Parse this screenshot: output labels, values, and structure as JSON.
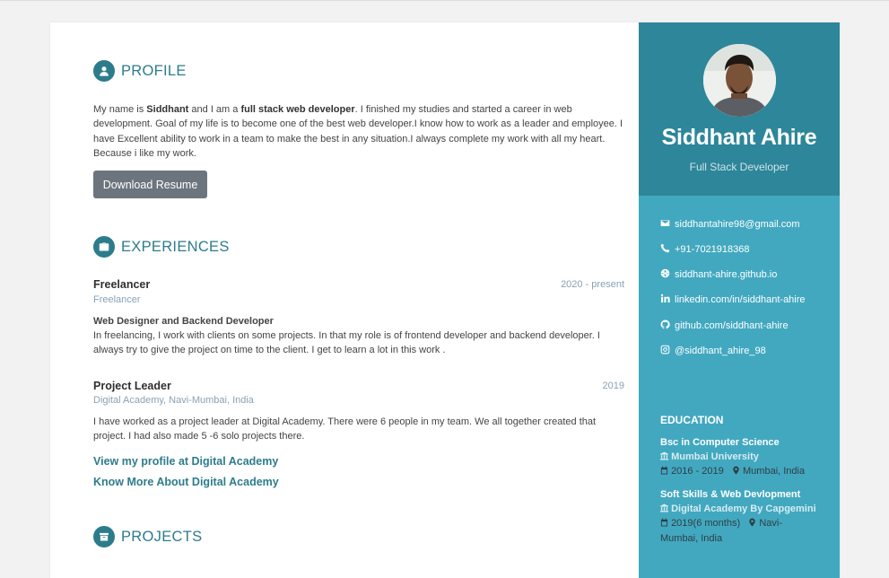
{
  "profile": {
    "heading": "PROFILE",
    "intro": "My name is ",
    "name_bold": "Siddhant",
    "mid": " and I am a ",
    "role_bold": "full stack web developer",
    "rest": ". I finished my studies and started a career in web development. Goal of my life is to become one of the best web developer.I know how to work as a leader and employee. I have Excellent ability to work in a team to make the best in any situation.I always complete my work with all my heart. Because i like my work.",
    "download_label": "Download Resume"
  },
  "experiences": {
    "heading": "EXPERIENCES",
    "items": [
      {
        "title": "Freelancer",
        "company": "Freelancer",
        "date": "2020 - present",
        "role": "Web Designer and Backend Developer",
        "description": "In freelancing, I work with clients on some projects. In that my role is of frontend developer and backend developer. I always try to give the project on time to the client. I get to learn a lot in this work ."
      },
      {
        "title": "Project Leader",
        "company": "Digital Academy, Navi-Mumbai, India",
        "date": "2019",
        "description": "I have worked as a project leader at Digital Academy. There were 6 people in my team. We all together created that project. I had also made 5 -6 solo projects there."
      }
    ],
    "link_profile": "View my profile at Digital Academy",
    "link_more": "Know More About Digital Academy"
  },
  "projects": {
    "heading": "PROJECTS"
  },
  "sidebar": {
    "name": "Siddhant Ahire",
    "role": "Full Stack Developer",
    "contacts": {
      "email": "siddhantahire98@gmail.com",
      "phone": "+91-7021918368",
      "website": "siddhant-ahire.github.io",
      "linkedin": "linkedin.com/in/siddhant-ahire",
      "github": "github.com/siddhant-ahire",
      "instagram": "@siddhant_ahire_98"
    },
    "education": {
      "heading": "EDUCATION",
      "items": [
        {
          "degree": "Bsc in Computer Science",
          "institution": "Mumbai University",
          "years": "2016 - 2019",
          "location": "Mumbai, India"
        },
        {
          "degree": "Soft Skills & Web Devlopment",
          "institution": "Digital Academy By Capgemini",
          "years": "2019(6 months)",
          "location": "Navi-Mumbai, India"
        }
      ]
    }
  },
  "colors": {
    "accent": "#2d7c8c",
    "sidebar": "#42a8c0",
    "sidebar_header": "#2d869a",
    "button": "#6c757d"
  },
  "icons": {
    "profile": "user-icon",
    "experiences": "briefcase-icon",
    "projects": "archive-icon"
  }
}
